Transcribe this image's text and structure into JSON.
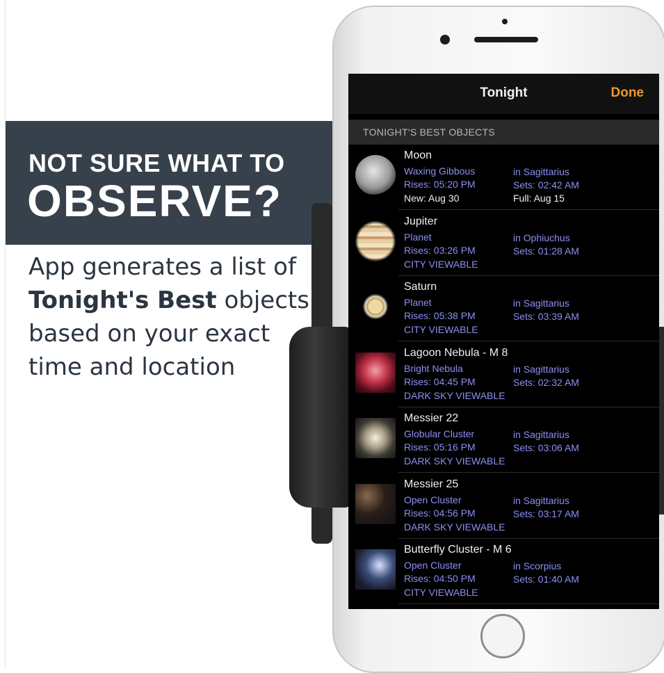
{
  "promo": {
    "headline_small": "NOT SURE WHAT TO",
    "headline_large": "OBSERVE?",
    "blurb_before": "App generates a list of",
    "blurb_bold": "Tonight's Best",
    "blurb_after": "objects based on your exact time and location"
  },
  "nav": {
    "title": "Tonight",
    "done_label": "Done"
  },
  "section_header": "TONIGHT'S BEST OBJECTS",
  "objects": [
    {
      "name": "Moon",
      "type": "Waxing Gibbous",
      "constellation": "in Sagittarius",
      "rises": "Rises: 05:20 PM",
      "sets": "Sets: 02:42 AM",
      "extra_left": "New: Aug 30",
      "extra_right": "Full: Aug 15"
    },
    {
      "name": "Jupiter",
      "type": "Planet",
      "constellation": "in Ophiuchus",
      "rises": "Rises: 03:26 PM",
      "sets": "Sets: 01:28 AM",
      "extra_left": "CITY VIEWABLE",
      "extra_right": ""
    },
    {
      "name": "Saturn",
      "type": "Planet",
      "constellation": "in Sagittarius",
      "rises": "Rises: 05:38 PM",
      "sets": "Sets: 03:39 AM",
      "extra_left": "CITY VIEWABLE",
      "extra_right": ""
    },
    {
      "name": "Lagoon Nebula - M 8",
      "type": "Bright Nebula",
      "constellation": "in Sagittarius",
      "rises": "Rises: 04:45 PM",
      "sets": "Sets: 02:32 AM",
      "extra_left": "DARK SKY VIEWABLE",
      "extra_right": ""
    },
    {
      "name": "Messier 22",
      "type": "Globular Cluster",
      "constellation": "in Sagittarius",
      "rises": "Rises: 05:16 PM",
      "sets": "Sets: 03:06 AM",
      "extra_left": "DARK SKY VIEWABLE",
      "extra_right": ""
    },
    {
      "name": "Messier 25",
      "type": "Open Cluster",
      "constellation": "in Sagittarius",
      "rises": "Rises: 04:56 PM",
      "sets": "Sets: 03:17 AM",
      "extra_left": "DARK SKY VIEWABLE",
      "extra_right": ""
    },
    {
      "name": "Butterfly Cluster - M 6",
      "type": "Open Cluster",
      "constellation": "in Scorpius",
      "rises": "Rises: 04:50 PM",
      "sets": "Sets: 01:40 AM",
      "extra_left": "CITY VIEWABLE",
      "extra_right": ""
    }
  ],
  "colors": {
    "banner": "#36414b",
    "accent": "#f0952e",
    "info_text": "#8d8ff2"
  }
}
